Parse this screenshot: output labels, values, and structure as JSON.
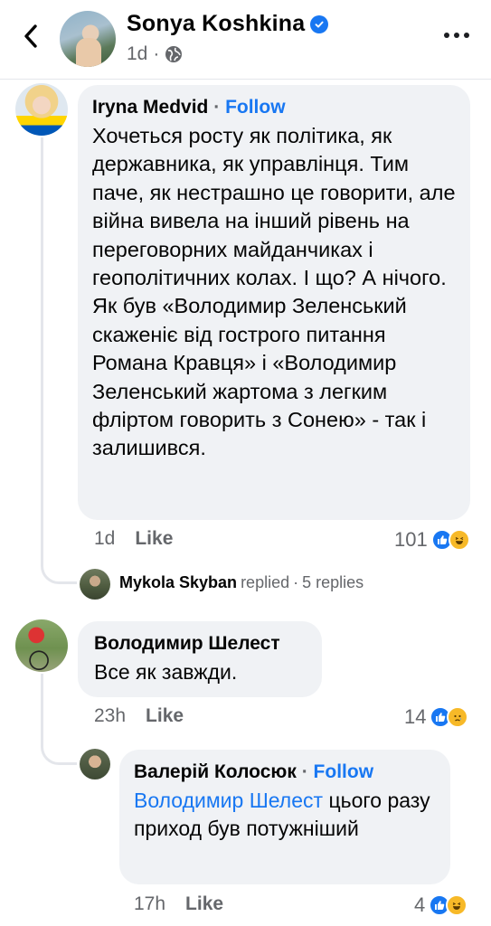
{
  "header": {
    "name": "Sonya Koshkina",
    "meta_time": "1d",
    "meta_dot": "·"
  },
  "comments": [
    {
      "author": "Iryna Medvid",
      "follow": "Follow",
      "separator": "·",
      "text": "Хочеться росту як політика, як державника, як управлінця. Тим паче, як нестрашно це говорити, але війна вивела на інший рівень на переговорних майданчиках і геополітичних колах. І що? А нічого. Як був «Володимир Зеленський скаженіє від гострого питання Романа Кравця» і «Володимир Зеленський жартома з легким флiртом говорить з Сонею» - так і залишився.",
      "time": "1d",
      "like_label": "Like",
      "reaction_count": "101",
      "reactions": [
        "like-reaction-icon",
        "haha-reaction-icon"
      ],
      "replies_summary": {
        "author": "Mykola Skyban",
        "verb": "replied",
        "dot": "·",
        "count_text": "5 replies"
      }
    },
    {
      "author": "Володимир Шелест",
      "text": "Все як завжди.",
      "time": "23h",
      "like_label": "Like",
      "reaction_count": "14",
      "reactions": [
        "like-reaction-icon",
        "sad-reaction-icon"
      ]
    },
    {
      "author": "Валерій Колосюк",
      "follow": "Follow",
      "separator": "·",
      "mention": "Володимир Шелест",
      "text": "цього разу приход був потужніший",
      "time": "17h",
      "like_label": "Like",
      "reaction_count": "4",
      "reactions": [
        "like-reaction-icon",
        "haha-reaction-icon"
      ]
    }
  ],
  "colors": {
    "accent": "#1877f2",
    "bubble": "#f0f2f5",
    "muted_text": "#65676b",
    "thread_line": "#e4e6eb",
    "haha": "#f7b928"
  }
}
